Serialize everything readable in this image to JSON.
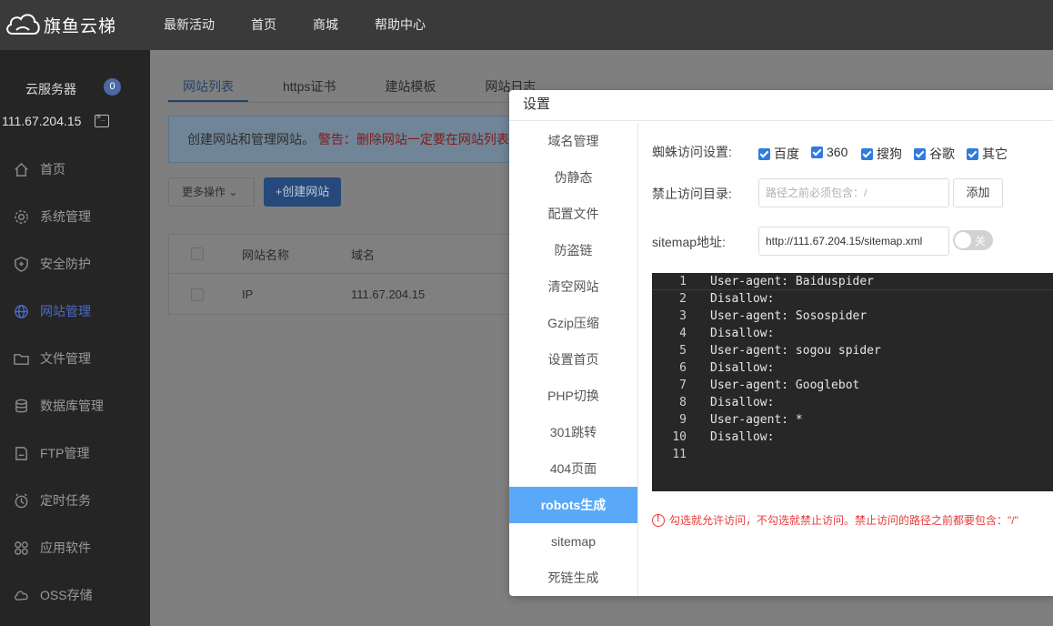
{
  "header": {
    "logo_text": "旗鱼云梯",
    "nav": [
      "最新活动",
      "首页",
      "商城",
      "帮助中心"
    ]
  },
  "sidebar": {
    "server_label": "云服务器",
    "server_count": "0",
    "server_ip": "111.67.204.15",
    "menu": [
      {
        "label": "首页",
        "icon": "home-icon"
      },
      {
        "label": "系统管理",
        "icon": "gear-icon"
      },
      {
        "label": "安全防护",
        "icon": "shield-icon"
      },
      {
        "label": "网站管理",
        "icon": "globe-icon",
        "active": true
      },
      {
        "label": "文件管理",
        "icon": "folder-icon"
      },
      {
        "label": "数据库管理",
        "icon": "database-icon"
      },
      {
        "label": "FTP管理",
        "icon": "ftp-icon"
      },
      {
        "label": "定时任务",
        "icon": "clock-icon"
      },
      {
        "label": "应用软件",
        "icon": "apps-icon"
      },
      {
        "label": "OSS存储",
        "icon": "cloud-icon"
      }
    ]
  },
  "main": {
    "tabs": [
      "网站列表",
      "https证书",
      "建站模板",
      "网站日志"
    ],
    "notice_text": "创建网站和管理网站。",
    "notice_warning": "警告：删除网站一定要在网站列表",
    "more_button": "更多操作 ⌄",
    "create_button": "+创建网站",
    "table": {
      "columns": [
        "网站名称",
        "域名"
      ],
      "rows": [
        [
          "IP",
          "111.67.204.15"
        ]
      ]
    }
  },
  "modal": {
    "title": "设置",
    "nav": [
      "域名管理",
      "伪静态",
      "配置文件",
      "防盗链",
      "清空网站",
      "Gzip压缩",
      "设置首页",
      "PHP切换",
      "301跳转",
      "404页面",
      "robots生成",
      "sitemap",
      "死链生成"
    ],
    "active_nav": "robots生成",
    "spider_label": "蜘蛛访问设置:",
    "spiders": [
      {
        "label": "百度",
        "checked": true
      },
      {
        "label": "360",
        "checked": true
      },
      {
        "label": "搜狗",
        "checked": true
      },
      {
        "label": "谷歌",
        "checked": true
      },
      {
        "label": "其它",
        "checked": true
      }
    ],
    "forbid_label": "禁止访问目录:",
    "forbid_placeholder": "路径之前必须包含：/",
    "add_button": "添加",
    "sitemap_label": "sitemap地址:",
    "sitemap_value": "http://111.67.204.15/sitemap.xml",
    "toggle_label": "关",
    "toggle_on": false,
    "code_lines": [
      "User-agent: Baiduspider",
      "Disallow:",
      "User-agent: Sosospider",
      "Disallow:",
      "User-agent: sogou spider",
      "Disallow:",
      "User-agent: Googlebot",
      "Disallow:",
      "User-agent: *",
      "Disallow:",
      ""
    ],
    "hint": "勾选就允许访问，不勾选就禁止访问。禁止访问的路径之前都要包含：\"/\""
  },
  "colors": {
    "topbar": "#3a3a3a",
    "sidebar": "#252525",
    "active_nav": "#5aa9f8",
    "checkbox": "#2f7be0",
    "hint": "#e53b3b"
  }
}
